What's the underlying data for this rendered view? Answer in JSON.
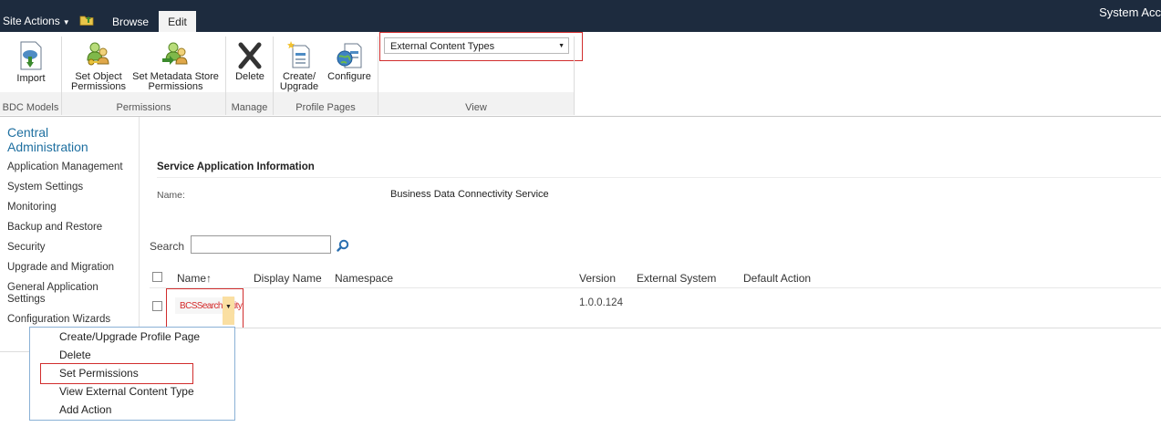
{
  "topbar": {
    "site_actions": "Site Actions",
    "tabs": [
      {
        "label": "Browse"
      },
      {
        "label": "Edit"
      }
    ],
    "user": "System Acc"
  },
  "ribbon": {
    "buttons": {
      "import": "Import",
      "set_object_permissions_1": "Set Object",
      "set_object_permissions_2": "Permissions",
      "set_metadata_permissions_1": "Set Metadata Store",
      "set_metadata_permissions_2": "Permissions",
      "delete": "Delete",
      "create_upgrade_1": "Create/",
      "create_upgrade_2": "Upgrade",
      "configure": "Configure"
    },
    "view_select": "External Content Types",
    "groups": {
      "bdc_models": "BDC Models",
      "permissions": "Permissions",
      "manage": "Manage",
      "profile_pages": "Profile Pages",
      "view": "View"
    }
  },
  "nav": {
    "title_line1": "Central",
    "title_line2": "Administration",
    "items": [
      "Application Management",
      "System Settings",
      "Monitoring",
      "Backup and Restore",
      "Security",
      "Upgrade and Migration",
      "General Application",
      "Settings",
      "Configuration Wizards"
    ]
  },
  "service_info": {
    "title": "Service Application Information",
    "name_label": "Name:",
    "name_value": "Business Data Connectivity Service"
  },
  "search": {
    "label": "Search",
    "value": ""
  },
  "table": {
    "columns": [
      "Name",
      "Display Name",
      "Namespace",
      "Version",
      "External System",
      "Default Action"
    ],
    "sort_arrow": "↑",
    "rows": [
      {
        "name": "BCSSearchEntity",
        "version": "1.0.0.124"
      }
    ]
  },
  "context_menu": {
    "items": [
      "Create/Upgrade Profile Page",
      "Delete",
      "Set Permissions",
      "View External Content Type",
      "Add Action"
    ]
  },
  "colors": {
    "topbar": "#1d2b3e",
    "highlight_red": "#d12d2d",
    "nav_title": "#1e6fa0",
    "entity_name": "#d42a2a"
  }
}
